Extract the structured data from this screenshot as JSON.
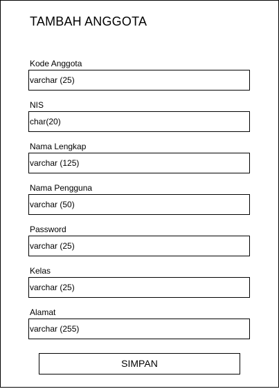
{
  "form": {
    "title": "TAMBAH ANGGOTA",
    "fields": [
      {
        "label": "Kode Anggota",
        "value": "varchar (25)"
      },
      {
        "label": "NIS",
        "value": "char(20)"
      },
      {
        "label": "Nama Lengkap",
        "value": "varchar (125)"
      },
      {
        "label": "Nama Pengguna",
        "value": "varchar (50)"
      },
      {
        "label": "Password",
        "value": "varchar (25)"
      },
      {
        "label": "Kelas",
        "value": "varchar (25)"
      },
      {
        "label": "Alamat",
        "value": "varchar (255)"
      }
    ],
    "submit_label": "SIMPAN"
  }
}
